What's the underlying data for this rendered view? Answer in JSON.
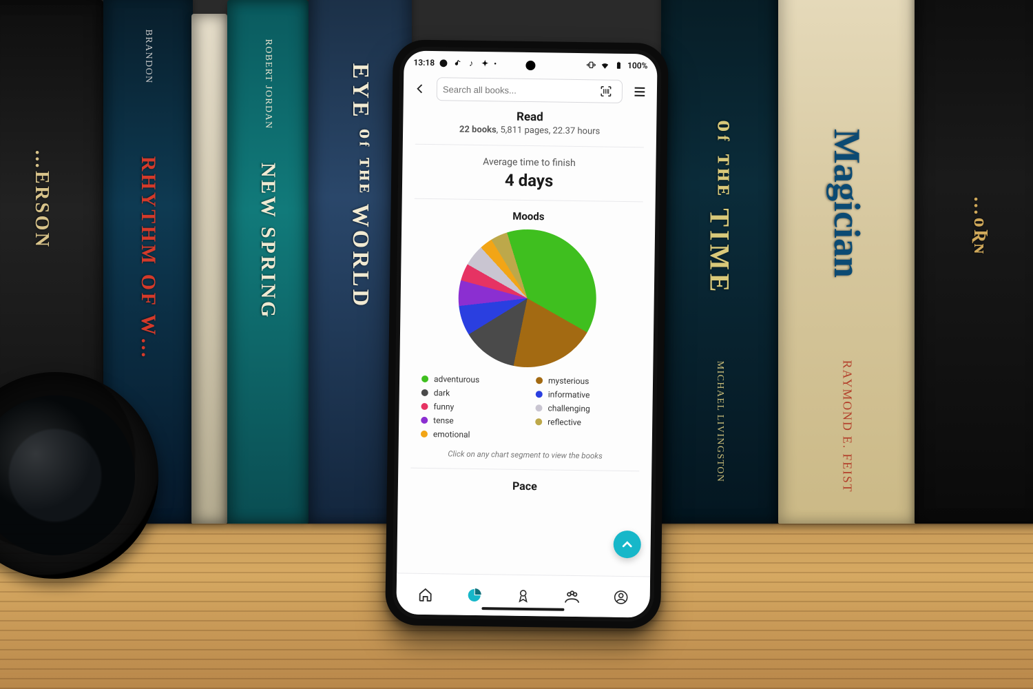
{
  "statusbar": {
    "time": "13:18",
    "battery": "100%"
  },
  "appbar": {
    "search_placeholder": "Search all books..."
  },
  "read": {
    "title": "Read",
    "books_label": "22 books",
    "detail_rest": ", 5,811 pages, 22.37 hours"
  },
  "avg": {
    "label": "Average time to finish",
    "value": "4 days"
  },
  "moods": {
    "title": "Moods",
    "hint": "Click on any chart segment to view the books",
    "legend_left": [
      {
        "name": "adventurous",
        "color": "#3fbf1f"
      },
      {
        "name": "dark",
        "color": "#4a4a4a"
      },
      {
        "name": "funny",
        "color": "#e63363"
      },
      {
        "name": "tense",
        "color": "#8b2fd1"
      },
      {
        "name": "emotional",
        "color": "#f2a516"
      }
    ],
    "legend_right": [
      {
        "name": "mysterious",
        "color": "#a36a12"
      },
      {
        "name": "informative",
        "color": "#2a3fe0"
      },
      {
        "name": "challenging",
        "color": "#c9c5d1"
      },
      {
        "name": "reflective",
        "color": "#bda84a"
      }
    ]
  },
  "pace": {
    "title": "Pace"
  },
  "chart_data": {
    "type": "pie",
    "title": "Moods",
    "series": [
      {
        "name": "adventurous",
        "value": 38,
        "color": "#3fbf1f"
      },
      {
        "name": "mysterious",
        "value": 20,
        "color": "#a36a12"
      },
      {
        "name": "dark",
        "value": 13,
        "color": "#4a4a4a"
      },
      {
        "name": "informative",
        "value": 7,
        "color": "#2a3fe0"
      },
      {
        "name": "tense",
        "value": 6,
        "color": "#8b2fd1"
      },
      {
        "name": "funny",
        "value": 4,
        "color": "#e63363"
      },
      {
        "name": "challenging",
        "value": 5,
        "color": "#c9c5d1"
      },
      {
        "name": "emotional",
        "value": 3,
        "color": "#f2a516"
      },
      {
        "name": "reflective",
        "value": 4,
        "color": "#bda84a"
      }
    ]
  }
}
